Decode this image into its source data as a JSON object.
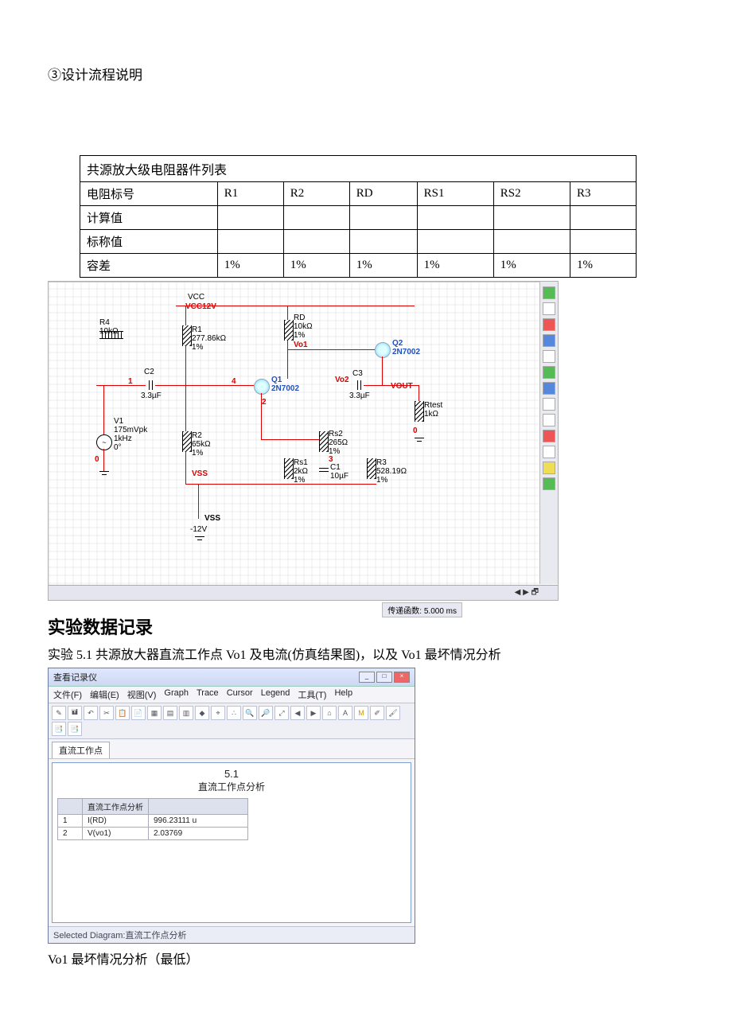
{
  "section_label": "③设计流程说明",
  "table": {
    "title": "共源放大级电阻器件列表",
    "rows": {
      "r_hdr": "电阻标号",
      "r1": "R1",
      "r2": "R2",
      "rd": "RD",
      "rs1": "RS1",
      "rs2": "RS2",
      "r3": "R3",
      "calc": "计算值",
      "nominal": "标称值",
      "tol": "容差",
      "tol_v": "1%"
    }
  },
  "schematic": {
    "vcc": "VCC",
    "vcc12": "12V",
    "r4": "R4\n10kΩ",
    "r1": "R1\n277.86kΩ\n1%",
    "rd": "RD\n10kΩ\n1%",
    "q1": "Q1\n2N7002",
    "q2": "Q2\n2N7002",
    "c2": "C2\n3.3µF",
    "c3": "C3\n3.3µF",
    "c1": "C1\n10µF",
    "v1": "V1\n175mVpk\n1kHz\n0°",
    "r2": "R2\n65kΩ\n1%",
    "rs2": "Rs2\n265Ω\n1%",
    "rs1": "Rs1\n2kΩ\n1%",
    "r3": "R3\n528.19Ω\n1%",
    "rtest": "Rtest\n1kΩ",
    "vss": "VSS",
    "vss12": "-12V",
    "vo1": "Vo1",
    "vo2": "Vo2",
    "vout": "VOUT",
    "n1": "1",
    "n2": "2",
    "n3": "3",
    "n4": "4",
    "n0": "0",
    "footer": "传递函数: 5.000 ms",
    "scroll": "◀ ▶ 🗗"
  },
  "data_rec_heading": "实验数据记录",
  "exp_line": "实验 5.1 共源放大器直流工作点 Vo1 及电流(仿真结果图)，以及 Vo1 最坏情况分析",
  "grapher": {
    "window_title": "查看记录仪",
    "menu": [
      "文件(F)",
      "编辑(E)",
      "视图(V)",
      "Graph",
      "Trace",
      "Cursor",
      "Legend",
      "工具(T)",
      "Help"
    ],
    "tab": "直流工作点",
    "plot_title": "5.1",
    "plot_sub": "直流工作点分析",
    "col_header": "直流工作点分析",
    "rows": [
      {
        "idx": "1",
        "name": "I(RD)",
        "val": "996.23111 u"
      },
      {
        "idx": "2",
        "name": "V(vo1)",
        "val": "2.03769"
      }
    ],
    "footer": "Selected Diagram:直流工作点分析"
  },
  "caption": "Vo1 最坏情况分析（最低）",
  "chart_data": {
    "type": "table",
    "title": "5.1 直流工作点分析",
    "columns": [
      "",
      "直流工作点分析"
    ],
    "rows": [
      {
        "label": "I(RD)",
        "value": 996.23111,
        "unit": "u"
      },
      {
        "label": "V(vo1)",
        "value": 2.03769,
        "unit": ""
      }
    ]
  }
}
